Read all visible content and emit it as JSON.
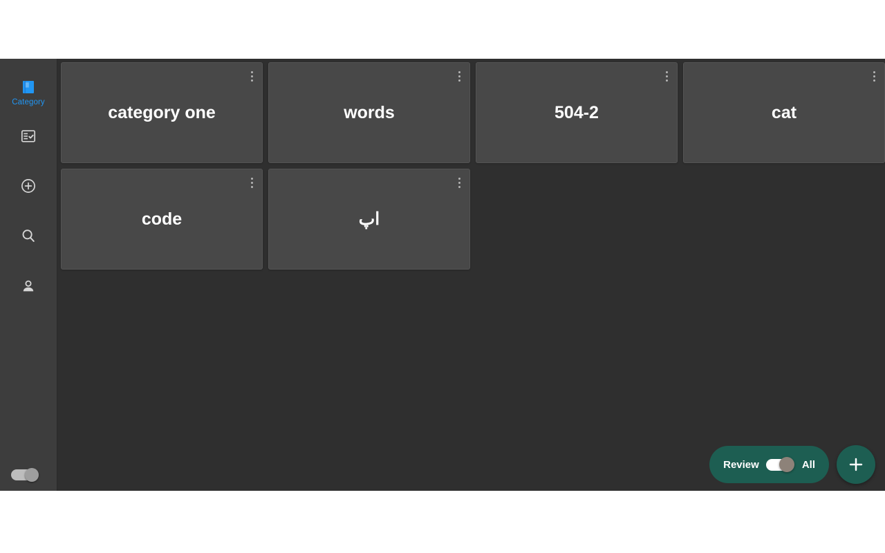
{
  "theme": {
    "page_background": "#ffffff",
    "app_background": "#2f2f2f",
    "sidebar_background": "#3d3d3d",
    "card_background": "#484848",
    "accent_blue": "#2196f3",
    "accent_teal": "#1d5e52",
    "text_primary": "#ffffff",
    "menu_dot": "#b5b5b5"
  },
  "sidebar": {
    "items": [
      {
        "id": "category",
        "icon": "book-icon",
        "label": "Category",
        "active": true
      },
      {
        "id": "review",
        "icon": "fact-check-icon",
        "label": "",
        "active": false
      },
      {
        "id": "add",
        "icon": "plus-circle-icon",
        "label": "",
        "active": false
      },
      {
        "id": "search",
        "icon": "search-icon",
        "label": "",
        "active": false
      },
      {
        "id": "account",
        "icon": "person-icon",
        "label": "",
        "active": false
      }
    ],
    "theme_toggle": {
      "icon": "theme-toggle",
      "checked": true
    }
  },
  "main": {
    "cards": [
      {
        "title": "category one",
        "menu_icon": "more-vertical-icon"
      },
      {
        "title": "words",
        "menu_icon": "more-vertical-icon"
      },
      {
        "title": "504-2",
        "menu_icon": "more-vertical-icon"
      },
      {
        "title": "cat",
        "menu_icon": "more-vertical-icon"
      },
      {
        "title": "code",
        "menu_icon": "more-vertical-icon"
      },
      {
        "title": "اپ",
        "menu_icon": "more-vertical-icon"
      }
    ]
  },
  "bottom_controls": {
    "review_pill": {
      "left_label": "Review",
      "right_label": "All",
      "switch_icon": "toggle-switch",
      "switch_on": true
    },
    "fab": {
      "icon": "plus-icon",
      "label": "+"
    }
  }
}
